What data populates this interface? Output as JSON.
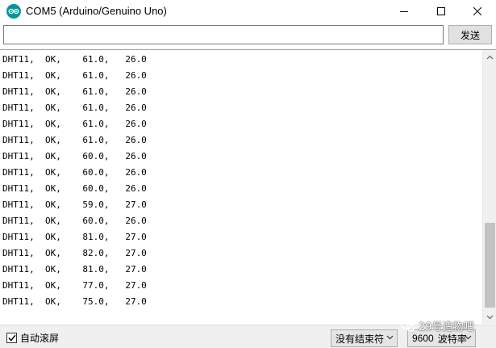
{
  "window": {
    "title": "COM5 (Arduino/Genuino Uno)",
    "icon": "arduino-logo-icon",
    "controls": [
      "minimize-icon",
      "maximize-icon",
      "close-icon"
    ]
  },
  "send": {
    "input_value": "",
    "button_label": "发送"
  },
  "output": {
    "lines": [
      "DHT11,  OK,    61.0,   26.0",
      "DHT11,  OK,    61.0,   26.0",
      "DHT11,  OK,    61.0,   26.0",
      "DHT11,  OK,    61.0,   26.0",
      "DHT11,  OK,    61.0,   26.0",
      "DHT11,  OK,    61.0,   26.0",
      "DHT11,  OK,    60.0,   26.0",
      "DHT11,  OK,    60.0,   26.0",
      "DHT11,  OK,    60.0,   26.0",
      "DHT11,  OK,    59.0,   27.0",
      "DHT11,  OK,    60.0,   26.0",
      "DHT11,  OK,    81.0,   27.0",
      "DHT11,  OK,    82.0,   27.0",
      "DHT11,  OK,    81.0,   27.0",
      "DHT11,  OK,    77.0,   27.0",
      "DHT11,  OK,    75.0,   27.0"
    ]
  },
  "bottom": {
    "autoscroll_label": "自动滚屏",
    "autoscroll_checked": true,
    "line_ending": "没有结束符",
    "baud_value": "9600",
    "baud_unit": "波特率"
  },
  "watermark": {
    "text": "29号造物吧",
    "icon": "wechat-icon"
  },
  "colors": {
    "arduino_teal": "#00979c"
  }
}
